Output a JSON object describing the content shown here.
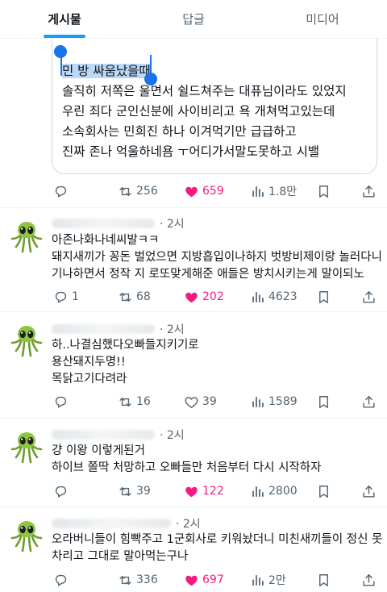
{
  "tabs": [
    {
      "label": "게시물",
      "active": true
    },
    {
      "label": "답글",
      "active": false
    },
    {
      "label": "미디어",
      "active": false
    }
  ],
  "main_post": {
    "highlighted_line": "민 방 싸움났을때",
    "lines": [
      "솔직히 저쪽은 울면서 쉴드쳐주는 대퓨님이라도 있었지",
      "우린 죄다 군인신분에 사이비리고 욕 개쳐먹고있는데",
      "소속회사는 민희진 하나 이겨먹기만 급급하고",
      "진짜 존나 억울하네욤 ㅜ어디가서말도못하고 시밸"
    ],
    "stats": {
      "reply": "",
      "retweet": "256",
      "like": "659",
      "views": "1.8만"
    }
  },
  "replies": [
    {
      "time": "· 2시",
      "lines": [
        "아존나화나네씨발ㅋㅋ",
        "돼지새끼가 꽁돈 벌었으면 지방흡입이나하지 벗방비제이랑 놀러다니",
        "기나하면서 정작 지 로또맞게해준 애들은 방치시키는게 말이되노"
      ],
      "stats": {
        "reply": "1",
        "retweet": "68",
        "like": "202",
        "views": "4623"
      },
      "liked": true
    },
    {
      "time": "· 2시",
      "lines": [
        "하..나결심했다오빠들지키기로",
        "용산돼지두명!!",
        "목닭고기다려라"
      ],
      "stats": {
        "reply": "",
        "retweet": "16",
        "like": "39",
        "views": "1589"
      },
      "liked": false
    },
    {
      "time": "· 2시",
      "lines": [
        "걍 이왕 이렇게된거",
        "하이브 쫄딱 처망하고 오빠들만 처음부터 다시 시작하자"
      ],
      "stats": {
        "reply": "",
        "retweet": "39",
        "like": "122",
        "views": "2800"
      },
      "liked": true
    },
    {
      "time": "· 2시",
      "lines": [
        "오라버니들이 힘빡주고 1군회사로 키워놨더니 미친새끼들이 정신 못",
        "차리고 그대로 말아먹는구나"
      ],
      "stats": {
        "reply": "",
        "retweet": "336",
        "like": "697",
        "views": "2만"
      },
      "liked": true
    }
  ],
  "colors": {
    "accent": "#1d9bf0",
    "like": "#f91880",
    "muted": "#536471",
    "selection": "#bcd8f7",
    "handle": "#1a73e8"
  },
  "icons": [
    "reply-icon",
    "retweet-icon",
    "like-icon",
    "views-icon",
    "bookmark-icon",
    "share-icon"
  ]
}
